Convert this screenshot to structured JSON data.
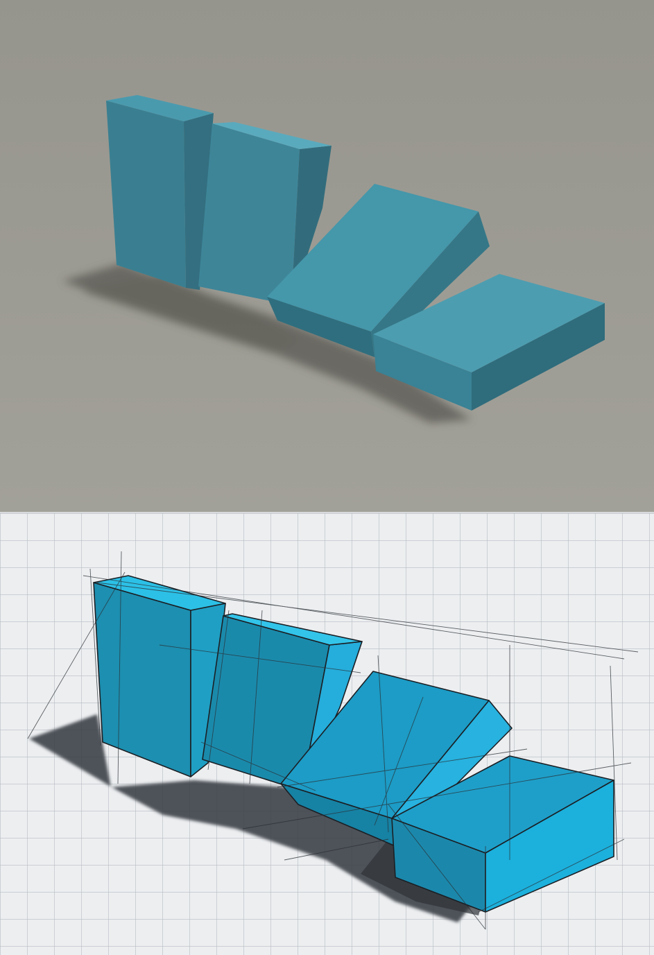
{
  "scene": {
    "top_panel": {
      "kind": "3d-render",
      "background_color": "#9b9a92",
      "block_color": "#3f8a9c",
      "shadow_color": "#5d5c57"
    },
    "bottom_panel": {
      "kind": "marker-sketch-on-grid-paper",
      "background_color": "#eceef0",
      "grid_color": "#b9bec4",
      "block_color": "#1aa3c8",
      "shadow_color": "#3c4046",
      "line_color": "#1b1f24"
    },
    "block_count": 4
  }
}
